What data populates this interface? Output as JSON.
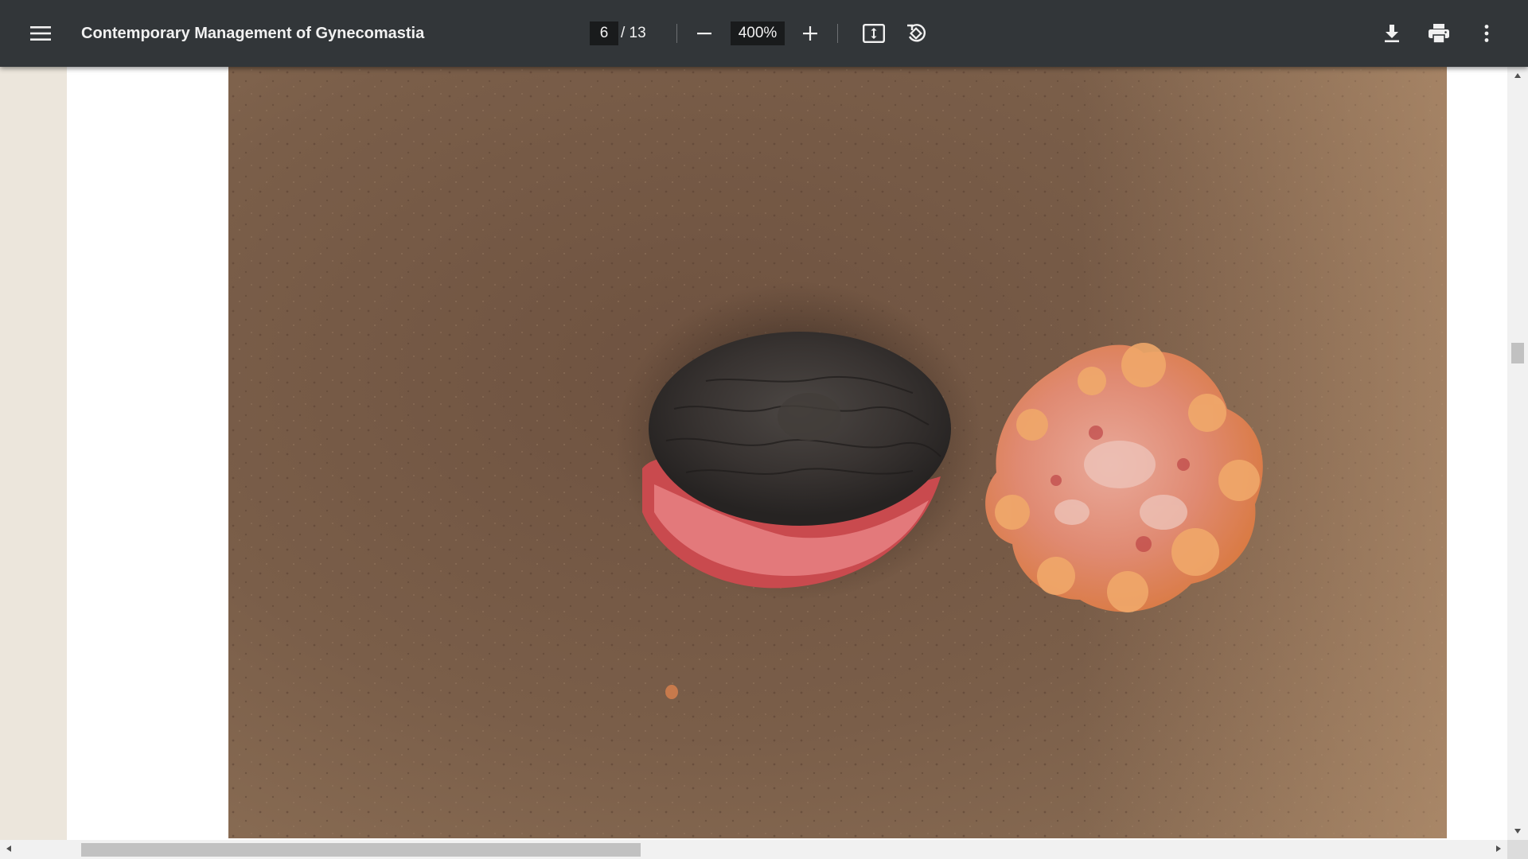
{
  "toolbar": {
    "title": "Contemporary Management of Gynecomastia",
    "current_page": "6",
    "page_separator": "/ 13",
    "zoom": "400%",
    "icons": {
      "menu": "menu-icon",
      "zoom_out": "minus-icon",
      "zoom_in": "plus-icon",
      "fit": "fit-to-page-icon",
      "rotate": "rotate-counterclockwise-icon",
      "download": "download-icon",
      "print": "print-icon",
      "more": "more-vertical-icon"
    }
  },
  "scroll": {
    "vertical_position": 0.36,
    "horizontal_position": 0.07,
    "horizontal_thumb_fraction": 0.38
  },
  "colors": {
    "toolbar_bg": "#323639",
    "viewer_bg": "#ece6dc",
    "page_bg": "#ffffff",
    "scrollbar_track": "#f1f1f1",
    "scrollbar_thumb": "#c1c1c1"
  }
}
